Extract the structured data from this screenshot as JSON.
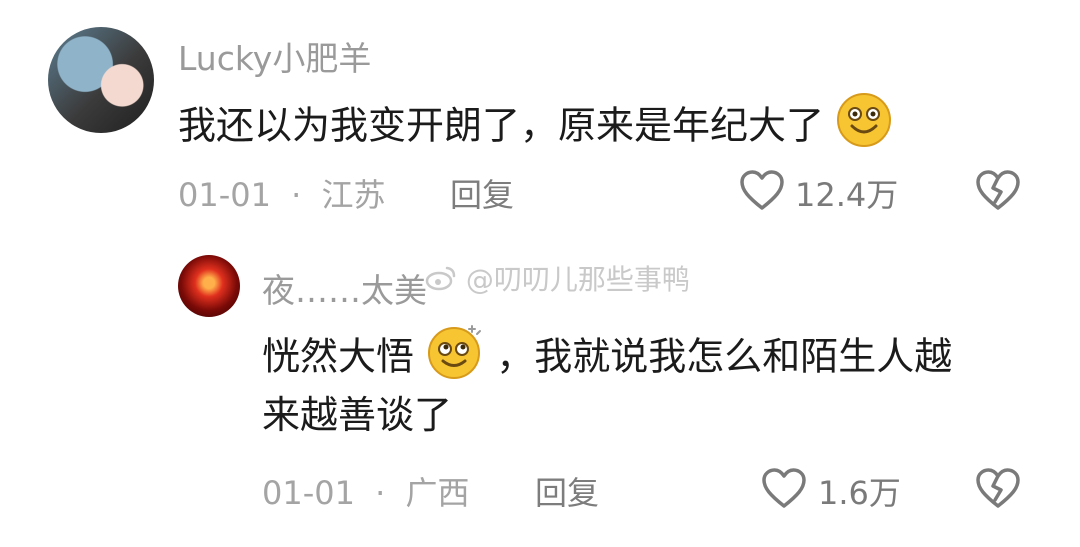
{
  "comments": [
    {
      "username": "Lucky小肥羊",
      "text": "我还以为我变开朗了，原来是年纪大了",
      "emoji": "grinning-face-emoji",
      "date": "01-01",
      "separator": "·",
      "location": "江苏",
      "reply_label": "回复",
      "likes": "12.4万"
    },
    {
      "username": "夜……太美",
      "text_line1_part1": "恍然大悟",
      "emoji": "dizzy-face-emoji",
      "text_line1_part2": "，我就说我怎么和陌生人越",
      "text_line2": "来越善谈了",
      "date": "01-01",
      "separator": "·",
      "location": "广西",
      "reply_label": "回复",
      "likes": "1.6万"
    }
  ],
  "watermark": "@叨叨儿那些事鸭",
  "icons": {
    "like": "heart-outline-icon",
    "dislike": "broken-heart-icon",
    "watermark_logo": "weibo-logo-icon"
  },
  "colors": {
    "text": "#1b1b1b",
    "muted": "#9a9a9a",
    "emoji": "#f7c531"
  }
}
